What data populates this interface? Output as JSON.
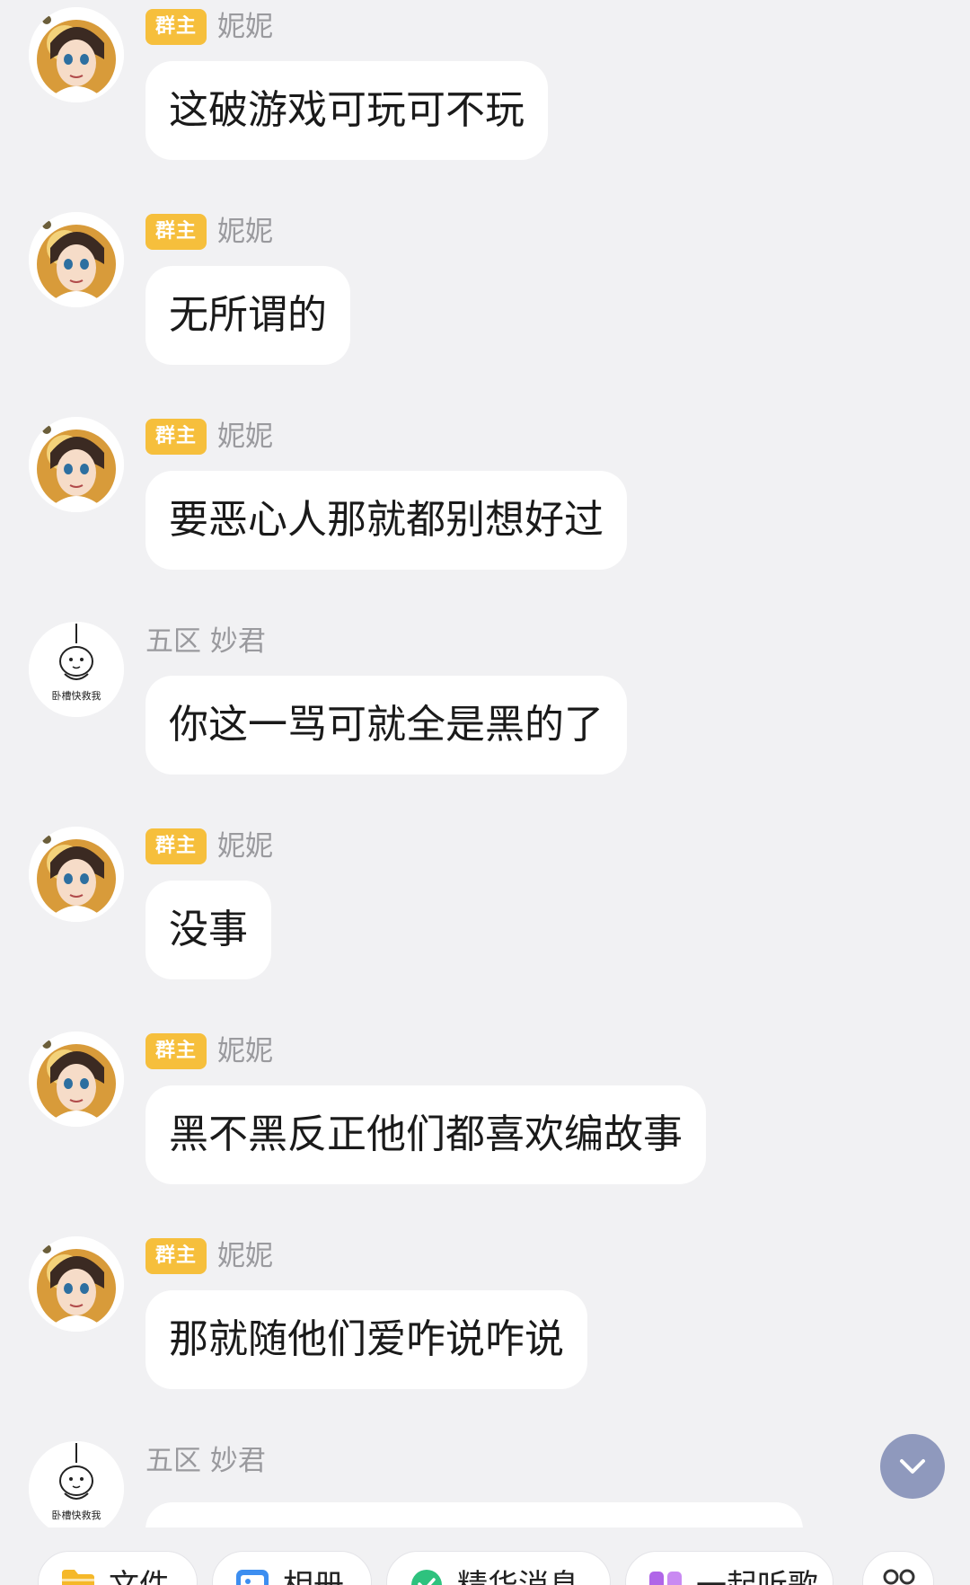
{
  "badge_label": "群主",
  "messages": [
    {
      "sender": "妮妮",
      "text": "这破游戏可玩可不玩"
    },
    {
      "sender": "妮妮",
      "text": "无所谓的"
    },
    {
      "sender": "妮妮",
      "text": "要恶心人那就都别想好过"
    },
    {
      "sender": "五区 妙君",
      "text": "你这一骂可就全是黑的了"
    },
    {
      "sender": "妮妮",
      "text": "没事"
    },
    {
      "sender": "妮妮",
      "text": "黑不黑反正他们都喜欢编故事"
    },
    {
      "sender": "妮妮",
      "text": "那就随他们爱咋说咋说"
    },
    {
      "sender": "五区 妙君",
      "text": ""
    }
  ],
  "avatar_caption": "卧槽快救我",
  "toolbar": {
    "items": [
      {
        "label": "文件",
        "icon": "folder-icon",
        "color": "#f5b829"
      },
      {
        "label": "相册",
        "icon": "photo-icon",
        "color": "#3d8ef0"
      },
      {
        "label": "精华消息",
        "icon": "essence-icon",
        "color": "#2ec27e"
      },
      {
        "label": "一起听歌",
        "icon": "music-icon",
        "color": "#b066e8"
      }
    ],
    "more_icon": "more-apps-icon"
  },
  "colors": {
    "background": "#f1f1f3",
    "bubble": "#ffffff",
    "badge": "#f6bf3c",
    "scroll_button": "#8f99bd"
  }
}
